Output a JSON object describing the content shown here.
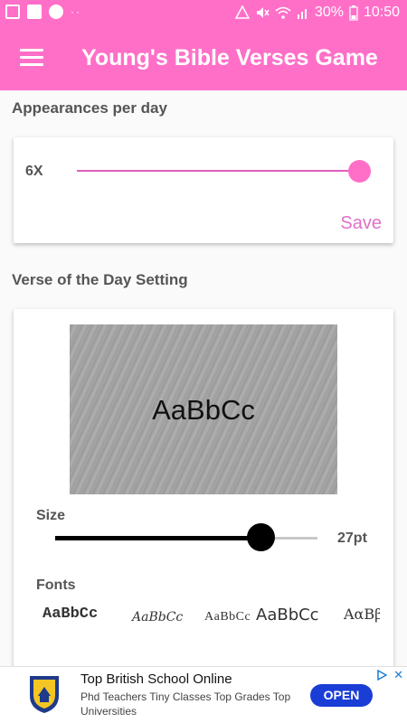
{
  "status_bar": {
    "battery_percent": "30%",
    "time": "10:50",
    "left_icons": [
      "image-icon",
      "news-icon",
      "face-icon",
      "more-dots-icon"
    ],
    "right_icons": [
      "warning-icon",
      "mute-icon",
      "wifi-icon",
      "signal-icon",
      "battery-icon"
    ]
  },
  "app_bar": {
    "title": "Young's Bible Verses Game",
    "color": "#ff6fc8"
  },
  "appearances": {
    "section_title": "Appearances per day",
    "value_label": "6X",
    "slider_fraction": 1.0,
    "save_label": "Save"
  },
  "verse_settings": {
    "section_title": "Verse of the Day Setting",
    "preview_text": "AaBbCc",
    "size_label": "Size",
    "size_value": "27pt",
    "size_slider_fraction": 0.79,
    "fonts_label": "Fonts",
    "font_options": [
      "AaBbCc",
      "AaBbCc",
      "AaBbCc",
      "AaBbCc",
      "AαBβ"
    ]
  },
  "ad": {
    "title": "Top British School Online",
    "description": "Phd Teachers Tiny Classes Top Grades Top Universities",
    "cta_label": "OPEN",
    "cta_color": "#1a3dd6"
  }
}
